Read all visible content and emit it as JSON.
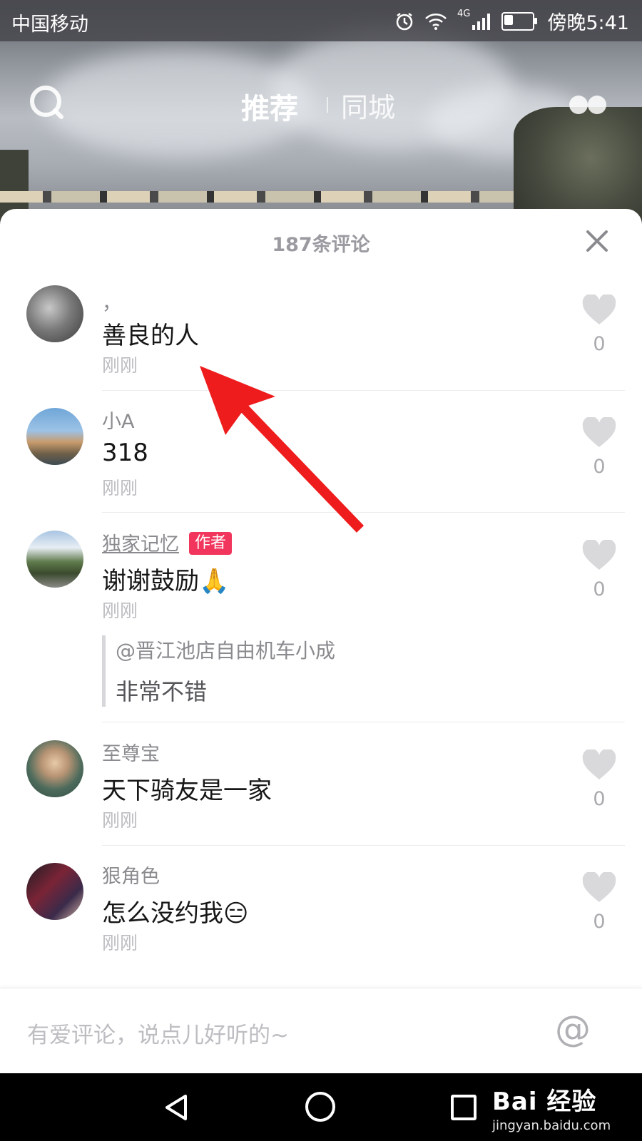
{
  "status_bar": {
    "carrier": "中国移动",
    "network": "4G",
    "time": "傍晚5:41"
  },
  "top_nav": {
    "tab_recommended": "推荐",
    "tab_local": "同城"
  },
  "comments_panel": {
    "title": "187条评论",
    "comments": [
      {
        "user": "，",
        "text": "善良的人",
        "time": "刚刚",
        "likes": "0"
      },
      {
        "user": "小A",
        "text": "318",
        "time": "刚刚",
        "likes": "0"
      },
      {
        "user": "独家记忆",
        "badge": "作者",
        "text": "谢谢鼓励🙏",
        "time": "刚刚",
        "likes": "0",
        "reply": {
          "user": "@晋江池店自由机车小成",
          "text": "非常不错"
        }
      },
      {
        "user": "至尊宝",
        "text": "天下骑友是一家",
        "time": "刚刚",
        "likes": "0"
      },
      {
        "user": "狠角色",
        "text": "怎么没约我😑",
        "time": "刚刚",
        "likes": "0"
      }
    ]
  },
  "input_bar": {
    "placeholder": "有爱评论，说点儿好听的~",
    "mention_symbol": "@"
  },
  "watermark": {
    "brand": "Bai 经验",
    "url": "jingyan.baidu.com"
  },
  "colors": {
    "author_badge": "#f2355c",
    "annotation_arrow": "#ee1c1c"
  }
}
